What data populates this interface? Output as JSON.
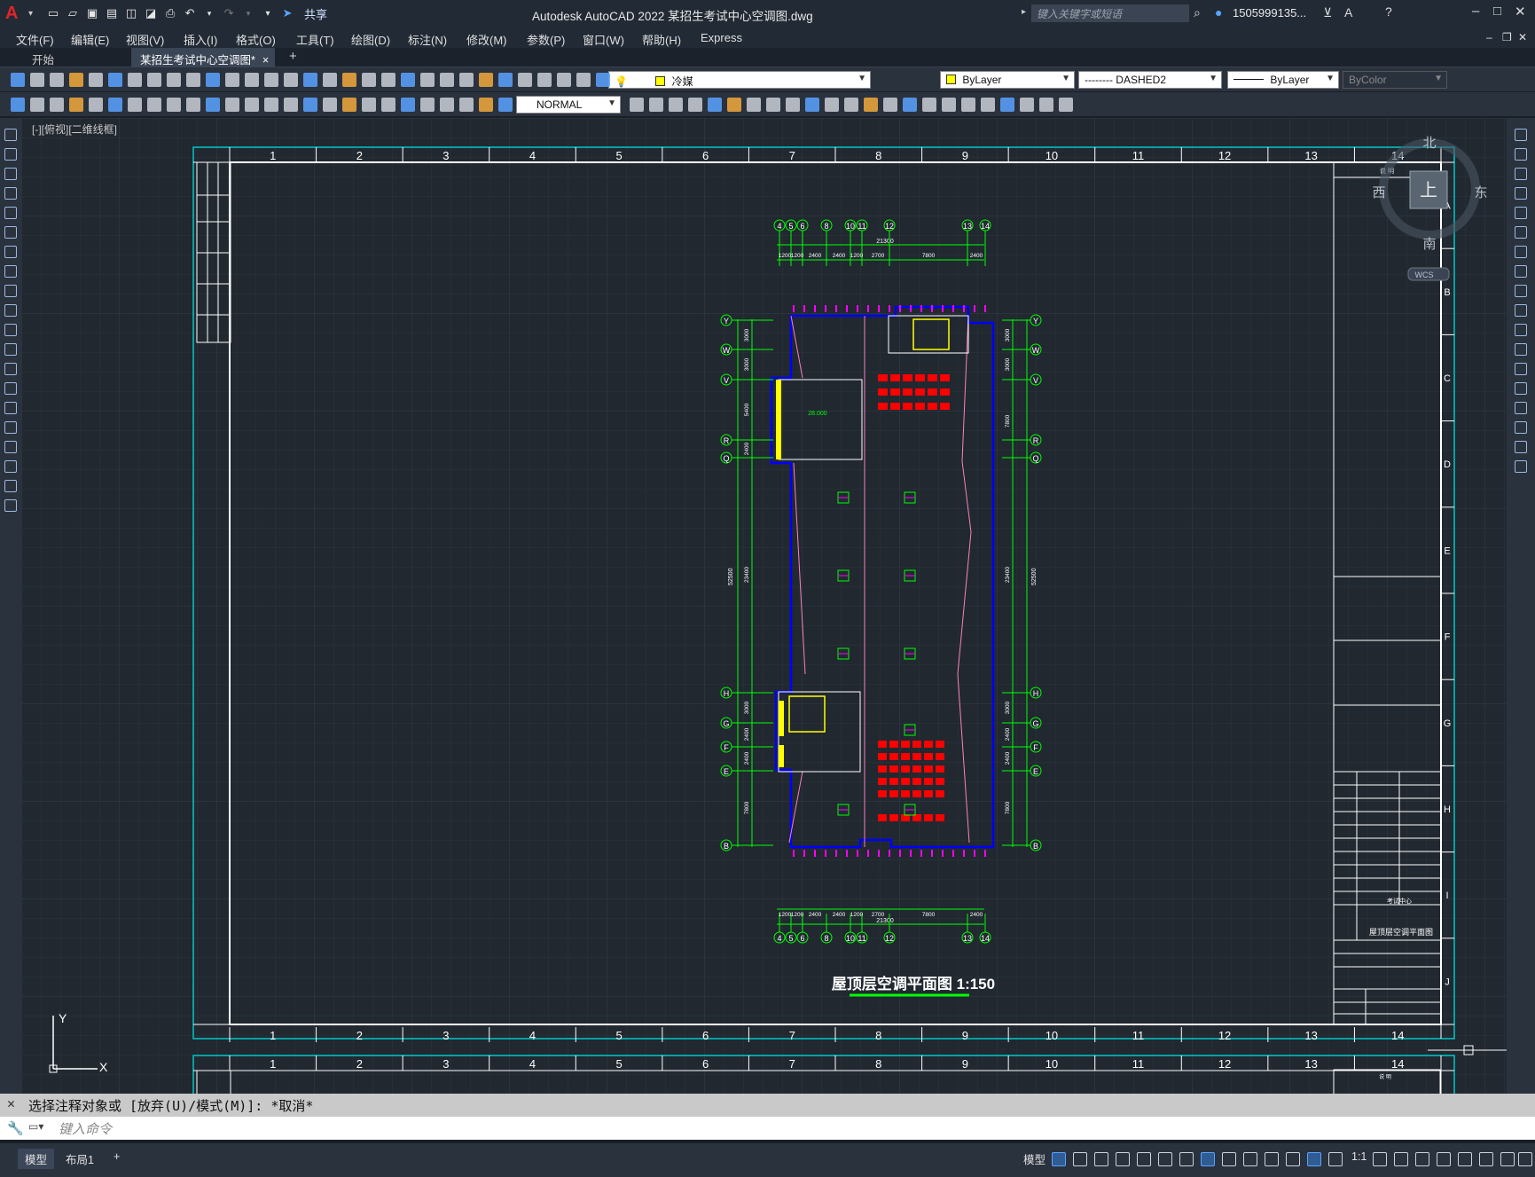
{
  "app": {
    "title": "Autodesk AutoCAD 2022    某招生考试中心空调图.dwg",
    "share_label": "共享",
    "search_placeholder": "键入关键字或短语",
    "user": "1505999135...",
    "logo": "A"
  },
  "menu": [
    "文件(F)",
    "编辑(E)",
    "视图(V)",
    "插入(I)",
    "格式(O)",
    "工具(T)",
    "绘图(D)",
    "标注(N)",
    "修改(M)",
    "参数(P)",
    "窗口(W)",
    "帮助(H)",
    "Express"
  ],
  "tabs": {
    "start": "开始",
    "drawing": "某招生考试中心空调图*",
    "close": "×",
    "add": "+"
  },
  "layer_toolbar": {
    "layer_name": "冷媒",
    "color": "ByLayer",
    "linetype": "-------- DASHED2",
    "lineweight": "ByLayer",
    "plotstyle": "ByColor"
  },
  "dim_toolbar": {
    "dim_style": "NORMAL"
  },
  "viewport": {
    "label": "[-][俯视][二维线框]",
    "viewcube": {
      "north": "北",
      "south": "南",
      "east": "东",
      "west": "西",
      "top": "上",
      "wcs": "WCS"
    },
    "ucs_x": "X",
    "ucs_y": "Y"
  },
  "drawing": {
    "title": "屋顶层空调平面图 1:150",
    "column_numbers": [
      "1",
      "2",
      "3",
      "4",
      "5",
      "6",
      "7",
      "8",
      "9",
      "10",
      "11",
      "12",
      "13",
      "14"
    ],
    "row_letters": [
      "A",
      "B",
      "C",
      "D",
      "E",
      "F",
      "G",
      "H",
      "I",
      "J"
    ],
    "axis_top": [
      "4",
      "5",
      "6",
      "8",
      "10",
      "11",
      "12",
      "13",
      "14"
    ],
    "axis_side": [
      "Y",
      "W",
      "V",
      "R",
      "Q",
      "H",
      "G",
      "F",
      "E",
      "B"
    ],
    "total_width": "21300",
    "total_height": "52500",
    "dims_top": [
      "1200",
      "1200",
      "2400",
      "2400",
      "1200",
      "2700",
      "7800",
      "2400"
    ],
    "dims_left": [
      "3000",
      "3000",
      "5400",
      "2400",
      "23400",
      "3000",
      "2400",
      "2400",
      "7800"
    ],
    "dims_right": [
      "3000",
      "3000",
      "7800",
      "23400",
      "3000",
      "2400",
      "2400",
      "7800"
    ],
    "titleblock_header": "说  明",
    "titleblock_project": "考试中心",
    "titleblock_drawing": "屋顶层空调平面图"
  },
  "command": {
    "history": "选择注释对象或 [放弃(U)/模式(M)]: *取消*",
    "prompt_placeholder": "键入命令"
  },
  "status": {
    "model": "模型",
    "layout1": "布局1",
    "add": "+",
    "model_space": "模型",
    "scale": "1:1"
  },
  "colors": {
    "cad_bg": "#212830",
    "green": "#00ff00",
    "blue": "#0000ff",
    "red": "#ff0000",
    "magenta": "#ff00ff",
    "yellow": "#ffff00",
    "cyan": "#00c8c8",
    "white": "#ffffff",
    "pink": "#ff80c0"
  }
}
